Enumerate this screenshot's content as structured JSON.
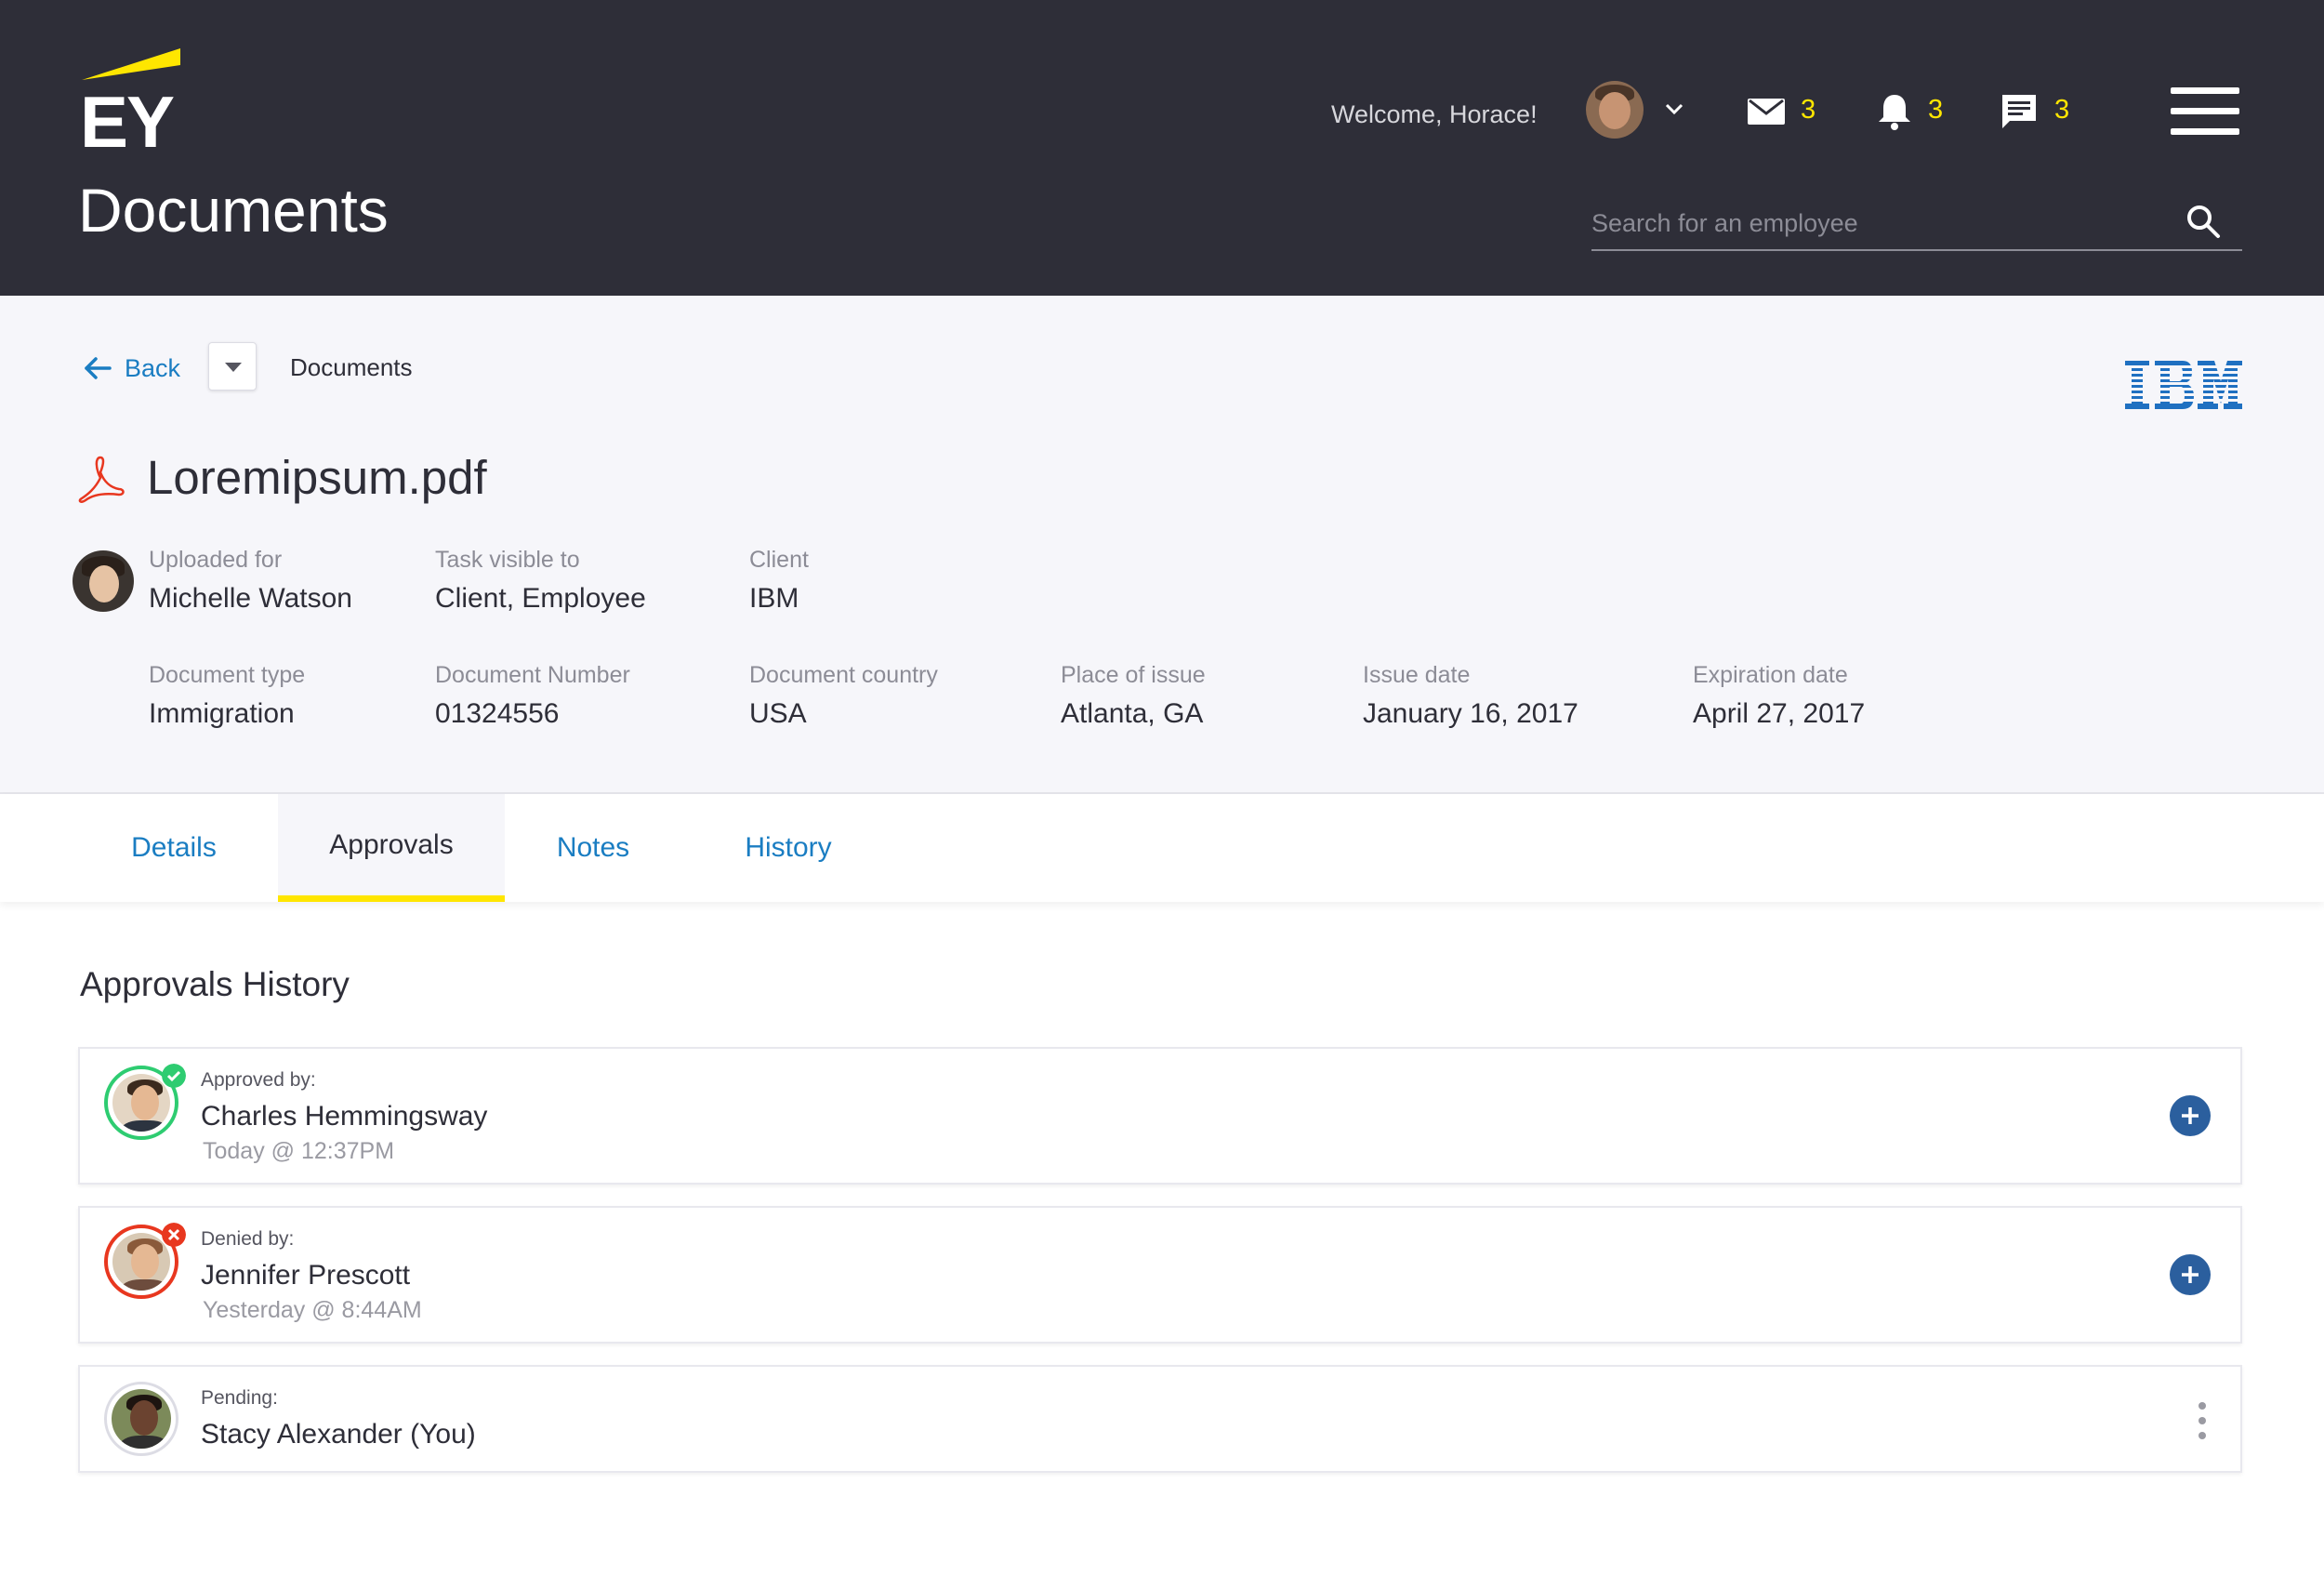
{
  "brand": {
    "logo_text": "EY",
    "accent_color": "#ffe600",
    "header_bg": "#2e2e38",
    "link_color": "#1a7dc2"
  },
  "header": {
    "page_title": "Documents",
    "welcome": "Welcome, Horace!",
    "mail_count": "3",
    "notifications_count": "3",
    "messages_count": "3",
    "search_placeholder": "Search for an employee"
  },
  "document": {
    "back_label": "Back",
    "breadcrumb": "Documents",
    "client_logo": "IBM",
    "title": "Loremipsum.pdf",
    "fields_row1": [
      {
        "label": "Uploaded for",
        "value": "Michelle Watson"
      },
      {
        "label": "Task visible to",
        "value": "Client, Employee"
      },
      {
        "label": "Client",
        "value": "IBM"
      }
    ],
    "fields_row2": [
      {
        "label": "Document type",
        "value": "Immigration"
      },
      {
        "label": "Document Number",
        "value": "01324556"
      },
      {
        "label": "Document country",
        "value": "USA"
      },
      {
        "label": "Place of issue",
        "value": "Atlanta, GA"
      },
      {
        "label": "Issue date",
        "value": "January 16, 2017"
      },
      {
        "label": "Expiration date",
        "value": "April 27, 2017"
      }
    ]
  },
  "tabs": [
    {
      "label": "Details",
      "active": false
    },
    {
      "label": "Approvals",
      "active": true
    },
    {
      "label": "Notes",
      "active": false
    },
    {
      "label": "History",
      "active": false
    }
  ],
  "approvals": {
    "title": "Approvals History",
    "items": [
      {
        "status_label": "Approved by:",
        "name": "Charles Hemmingsway",
        "time": "Today @ 12:37PM",
        "status": "approved",
        "status_color": "#2ecc71"
      },
      {
        "status_label": "Denied by:",
        "name": "Jennifer Prescott",
        "time": "Yesterday @ 8:44AM",
        "status": "denied",
        "status_color": "#e8371f"
      },
      {
        "status_label": "Pending:",
        "name": "Stacy Alexander (You)",
        "time": "",
        "status": "pending",
        "status_color": "#dcdce4"
      }
    ]
  }
}
